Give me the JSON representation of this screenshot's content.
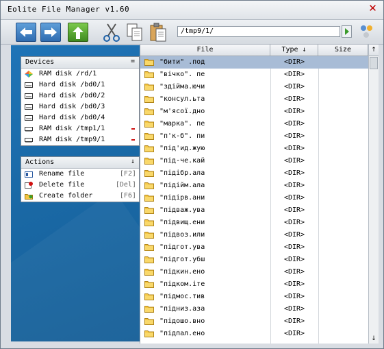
{
  "window": {
    "title": "Eolite File Manager v1.60",
    "close_glyph": "✕"
  },
  "toolbar": {
    "back": "back-arrow-icon",
    "forward": "forward-arrow-icon",
    "up": "up-arrow-icon",
    "cut": "scissors-icon",
    "copy": "copy-icon",
    "paste": "paste-icon",
    "path_value": "/tmp9/1/"
  },
  "devices": {
    "title": "Devices",
    "toggle": "=",
    "items": [
      {
        "label": "RAM disk /rd/1",
        "icon": "ramdisk-color-icon",
        "removable": false
      },
      {
        "label": "Hard disk /bd0/1",
        "icon": "harddisk-icon",
        "removable": false
      },
      {
        "label": "Hard disk /bd0/2",
        "icon": "harddisk-icon",
        "removable": false
      },
      {
        "label": "Hard disk /bd0/3",
        "icon": "harddisk-icon",
        "removable": false
      },
      {
        "label": "Hard disk /bd0/4",
        "icon": "harddisk-icon",
        "removable": false
      },
      {
        "label": "RAM disk /tmp1/1",
        "icon": "ramdisk-icon",
        "removable": true
      },
      {
        "label": "RAM disk /tmp9/1",
        "icon": "ramdisk-icon",
        "removable": true
      }
    ]
  },
  "actions": {
    "title": "Actions",
    "toggle": "↓",
    "items": [
      {
        "label": "Rename file",
        "shortcut": "[F2]",
        "icon": "rename-icon"
      },
      {
        "label": "Delete file",
        "shortcut": "[Del]",
        "icon": "delete-icon"
      },
      {
        "label": "Create folder",
        "shortcut": "[F6]",
        "icon": "new-folder-icon"
      }
    ]
  },
  "filelist": {
    "headers": {
      "file": "File",
      "type": "Type ↓",
      "size": "Size",
      "scroll_up": "↑",
      "scroll_down": "↓"
    },
    "rows": [
      {
        "name": "\"бити\" .под",
        "type": "<DIR>"
      },
      {
        "name": "\"вічко\". пе",
        "type": "<DIR>"
      },
      {
        "name": "\"здійма.ючи",
        "type": "<DIR>"
      },
      {
        "name": "\"консул.ьта",
        "type": "<DIR>"
      },
      {
        "name": "\"м'ясої.дно",
        "type": "<DIR>"
      },
      {
        "name": "\"марка\". пе",
        "type": "<DIR>"
      },
      {
        "name": "\"п'к-б\". пи",
        "type": "<DIR>"
      },
      {
        "name": "\"під'ид.жую",
        "type": "<DIR>"
      },
      {
        "name": "\"під-че.кай",
        "type": "<DIR>"
      },
      {
        "name": "\"підібр.ала",
        "type": "<DIR>"
      },
      {
        "name": "\"підійм.ала",
        "type": "<DIR>"
      },
      {
        "name": "\"підірв.ани",
        "type": "<DIR>"
      },
      {
        "name": "\"підваж.ува",
        "type": "<DIR>"
      },
      {
        "name": "\"підвищ.ени",
        "type": "<DIR>"
      },
      {
        "name": "\"підвоз.или",
        "type": "<DIR>"
      },
      {
        "name": "\"підгот.ува",
        "type": "<DIR>"
      },
      {
        "name": "\"підгот.убш",
        "type": "<DIR>"
      },
      {
        "name": "\"підкин.ено",
        "type": "<DIR>"
      },
      {
        "name": "\"підком.іте",
        "type": "<DIR>"
      },
      {
        "name": "\"підмос.тив",
        "type": "<DIR>"
      },
      {
        "name": "\"підниз.аза",
        "type": "<DIR>"
      },
      {
        "name": "\"підошо.вно",
        "type": "<DIR>"
      },
      {
        "name": "\"підпал.ено",
        "type": "<DIR>"
      }
    ]
  },
  "colors": {
    "selection": "#a8bcd6",
    "panel_blue": "#1a69a6",
    "remove_red": "#d01010",
    "folder_yellow": "#f5c542"
  }
}
